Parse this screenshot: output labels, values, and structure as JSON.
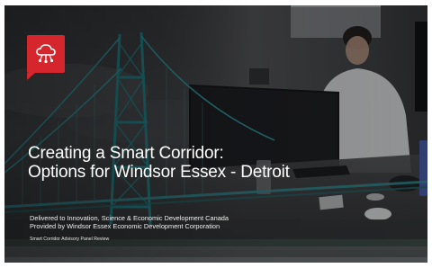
{
  "slide": {
    "logo_icon": "cloud-network-icon",
    "accent_color": "#d6262d",
    "title_lines": [
      "Creating a Smart Corridor:",
      "Options for Windsor Essex - Detroit"
    ],
    "delivered_to": "Delivered to Innovation, Science & Economic Development Canada",
    "provided_by": "Provided by Windsor Essex Economic Development Corporation",
    "footer": "Smart Corridor Advisory Panel Review"
  }
}
